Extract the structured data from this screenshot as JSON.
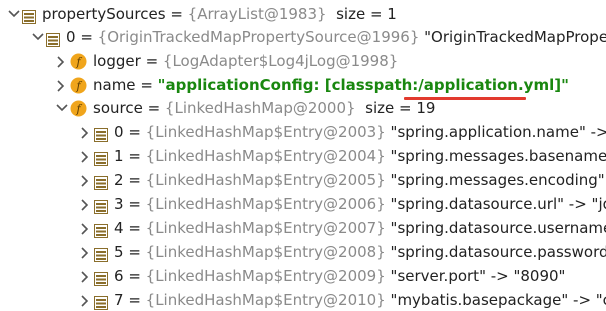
{
  "rows": [
    {
      "name": "propertySources",
      "type": "{ArrayList@1983}",
      "tail": "size = 1"
    },
    {
      "name": "0",
      "type": "{OriginTrackedMapPropertySource@1996}",
      "tail": "\"OriginTrackedMapPrope"
    },
    {
      "name": "logger",
      "type": "{LogAdapter$Log4jLog@1998}",
      "tail": ""
    },
    {
      "name": "name",
      "type": "",
      "tail": "\"applicationConfig: [classpath:/application.yml]\""
    },
    {
      "name": "source",
      "type": "{LinkedHashMap@2000}",
      "tail": "size = 19"
    },
    {
      "name": "0",
      "type": "{LinkedHashMap$Entry@2003}",
      "tail": "\"spring.application.name\" -> \""
    },
    {
      "name": "1",
      "type": "{LinkedHashMap$Entry@2004}",
      "tail": "\"spring.messages.basename\" -"
    },
    {
      "name": "2",
      "type": "{LinkedHashMap$Entry@2005}",
      "tail": "\"spring.messages.encoding\" -"
    },
    {
      "name": "3",
      "type": "{LinkedHashMap$Entry@2006}",
      "tail": "\"spring.datasource.url\" -> \"jdb"
    },
    {
      "name": "4",
      "type": "{LinkedHashMap$Entry@2007}",
      "tail": "\"spring.datasource.username\""
    },
    {
      "name": "5",
      "type": "{LinkedHashMap$Entry@2008}",
      "tail": "\"spring.datasource.password\""
    },
    {
      "name": "6",
      "type": "{LinkedHashMap$Entry@2009}",
      "tail": "\"server.port\" -> \"8090\""
    },
    {
      "name": "7",
      "type": "{LinkedHashMap$Entry@2010}",
      "tail": "\"mybatis.basepackage\" -> \"co"
    }
  ],
  "colors": {
    "string_value": "#19870f",
    "type_text": "#8a8a8a",
    "highlight_underline": "#e23a2e",
    "field_icon": "#f0a51c",
    "list_icon": "#8a6e2b"
  },
  "icons": {
    "expanded": "chevron-down-icon",
    "collapsed": "chevron-right-icon",
    "field": "field-icon",
    "list": "list-icon",
    "entry": "map-entry-icon"
  }
}
